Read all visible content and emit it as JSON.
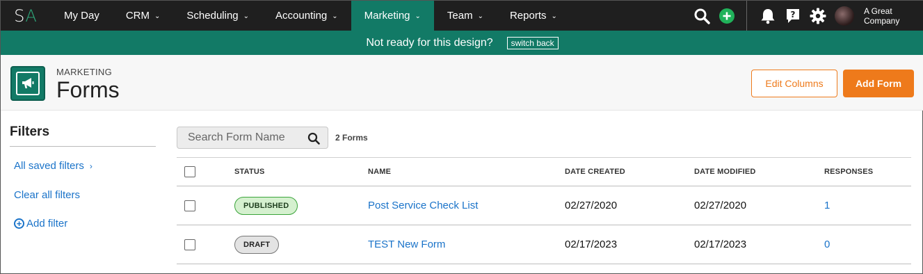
{
  "app": {
    "logo_s": "S",
    "logo_a": "A"
  },
  "nav": [
    {
      "label": "My Day",
      "has_chevron": false
    },
    {
      "label": "CRM",
      "has_chevron": true
    },
    {
      "label": "Scheduling",
      "has_chevron": true
    },
    {
      "label": "Accounting",
      "has_chevron": true
    },
    {
      "label": "Marketing",
      "has_chevron": true,
      "active": true
    },
    {
      "label": "Team",
      "has_chevron": true
    },
    {
      "label": "Reports",
      "has_chevron": true
    }
  ],
  "nav_icons": [
    "search-icon",
    "add-circle-icon",
    "bell-icon",
    "help-icon",
    "gear-icon"
  ],
  "company": {
    "line1": "A Great",
    "line2": "Company"
  },
  "banner": {
    "text": "Not ready for this design?",
    "button": "switch back"
  },
  "header": {
    "section": "MARKETING",
    "title": "Forms",
    "edit_columns": "Edit Columns",
    "add_form": "Add Form",
    "icon": "megaphone-icon"
  },
  "filters": {
    "title": "Filters",
    "saved": "All saved filters",
    "clear": "Clear all filters",
    "add": "Add filter"
  },
  "search": {
    "placeholder": "Search Form Name",
    "value": ""
  },
  "count": "2 Forms",
  "table": {
    "headers": {
      "status": "STATUS",
      "name": "NAME",
      "created": "DATE CREATED",
      "modified": "DATE MODIFIED",
      "responses": "RESPONSES"
    },
    "rows": [
      {
        "status": "PUBLISHED",
        "name": "Post Service Check List",
        "created": "02/27/2020",
        "modified": "02/27/2020",
        "responses": "1"
      },
      {
        "status": "DRAFT",
        "name": "TEST New Form",
        "created": "02/17/2023",
        "modified": "02/17/2023",
        "responses": "0"
      }
    ]
  },
  "colors": {
    "nav_bg": "#1f1f1f",
    "brand_green": "#127a66",
    "accent_orange": "#ee7a1b",
    "link_blue": "#1a73c9"
  }
}
